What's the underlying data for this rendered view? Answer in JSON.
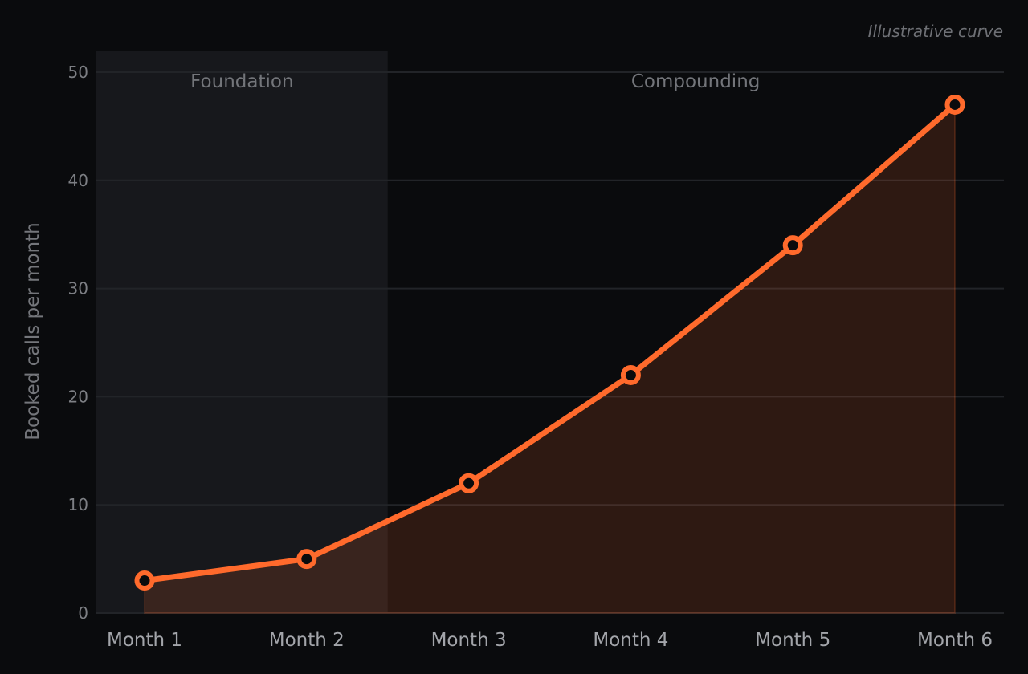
{
  "note": "Illustrative curve",
  "colors": {
    "background": "#0a0b0d",
    "foundation_band": "#17181c",
    "line": "#ff6a2c",
    "area_fill": "#ff6a2c",
    "grid": "#222428",
    "marker_inner": "#0a0b0d"
  },
  "phases": [
    {
      "label": "Foundation",
      "from": 0.5,
      "to": 2.5
    },
    {
      "label": "Compounding",
      "from": 2.5,
      "to": 6.3
    }
  ],
  "chart_data": {
    "type": "area",
    "title": "",
    "xlabel": "",
    "ylabel": "Booked calls per month",
    "categories": [
      "Month 1",
      "Month 2",
      "Month 3",
      "Month 4",
      "Month 5",
      "Month 6"
    ],
    "values": [
      3,
      5,
      12,
      22,
      34,
      47
    ],
    "ylim": [
      0,
      52
    ],
    "yticks": [
      0,
      10,
      20,
      30,
      40,
      50
    ],
    "grid": true,
    "legend": "none",
    "markers": true
  }
}
